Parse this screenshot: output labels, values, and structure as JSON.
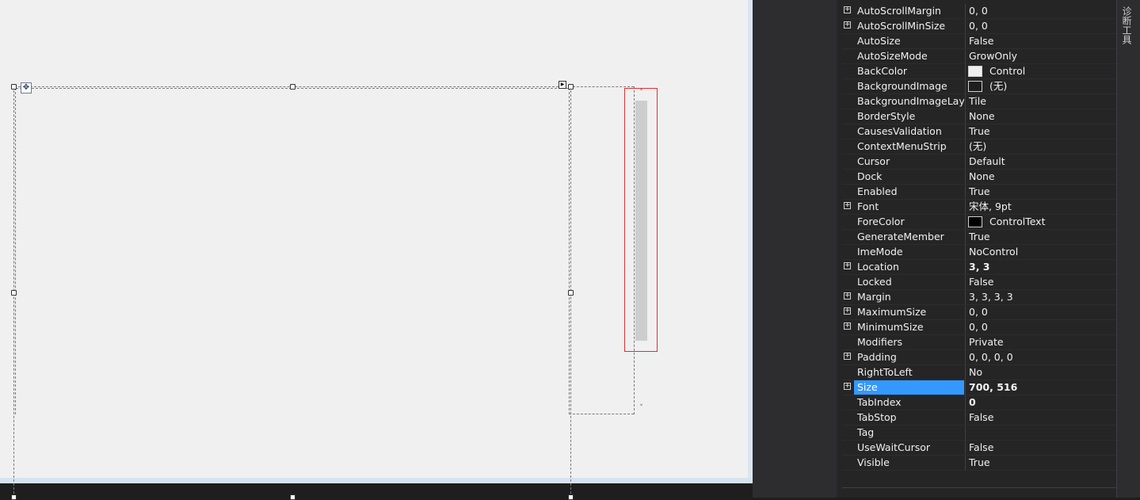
{
  "designer": {
    "move_icon": "move-arrows-icon",
    "smart_tag_icon": "smart-tag-arrow-icon",
    "scroll_up_glyph": "˄",
    "scroll_down_glyph": "˅"
  },
  "side_tab": {
    "label": "诊断工具"
  },
  "properties": [
    {
      "name": "AutoScrollMargin",
      "value": "0, 0",
      "expandable": true
    },
    {
      "name": "AutoScrollMinSize",
      "value": "0, 0",
      "expandable": true
    },
    {
      "name": "AutoSize",
      "value": "False"
    },
    {
      "name": "AutoSizeMode",
      "value": "GrowOnly"
    },
    {
      "name": "BackColor",
      "value": "Control",
      "swatch": "#f0f0f0"
    },
    {
      "name": "BackgroundImage",
      "value": "(无)",
      "swatch": "#1e1e1e"
    },
    {
      "name": "BackgroundImageLayout",
      "value": "Tile"
    },
    {
      "name": "BorderStyle",
      "value": "None"
    },
    {
      "name": "CausesValidation",
      "value": "True"
    },
    {
      "name": "ContextMenuStrip",
      "value": "(无)"
    },
    {
      "name": "Cursor",
      "value": "Default"
    },
    {
      "name": "Dock",
      "value": "None"
    },
    {
      "name": "Enabled",
      "value": "True"
    },
    {
      "name": "Font",
      "value": "宋体, 9pt",
      "expandable": true
    },
    {
      "name": "ForeColor",
      "value": "ControlText",
      "swatch": "#000000"
    },
    {
      "name": "GenerateMember",
      "value": "True"
    },
    {
      "name": "ImeMode",
      "value": "NoControl"
    },
    {
      "name": "Location",
      "value": "3, 3",
      "expandable": true,
      "bold": true
    },
    {
      "name": "Locked",
      "value": "False"
    },
    {
      "name": "Margin",
      "value": "3, 3, 3, 3",
      "expandable": true
    },
    {
      "name": "MaximumSize",
      "value": "0, 0",
      "expandable": true
    },
    {
      "name": "MinimumSize",
      "value": "0, 0",
      "expandable": true
    },
    {
      "name": "Modifiers",
      "value": "Private"
    },
    {
      "name": "Padding",
      "value": "0, 0, 0, 0",
      "expandable": true
    },
    {
      "name": "RightToLeft",
      "value": "No"
    },
    {
      "name": "Size",
      "value": "700, 516",
      "expandable": true,
      "bold": true,
      "selected": true
    },
    {
      "name": "TabIndex",
      "value": "0",
      "bold": true
    },
    {
      "name": "TabStop",
      "value": "False"
    },
    {
      "name": "Tag",
      "value": ""
    },
    {
      "name": "UseWaitCursor",
      "value": "False"
    },
    {
      "name": "Visible",
      "value": "True"
    }
  ],
  "colors": {
    "selection": "#3399ff",
    "scroll_outline": "#e03030"
  }
}
